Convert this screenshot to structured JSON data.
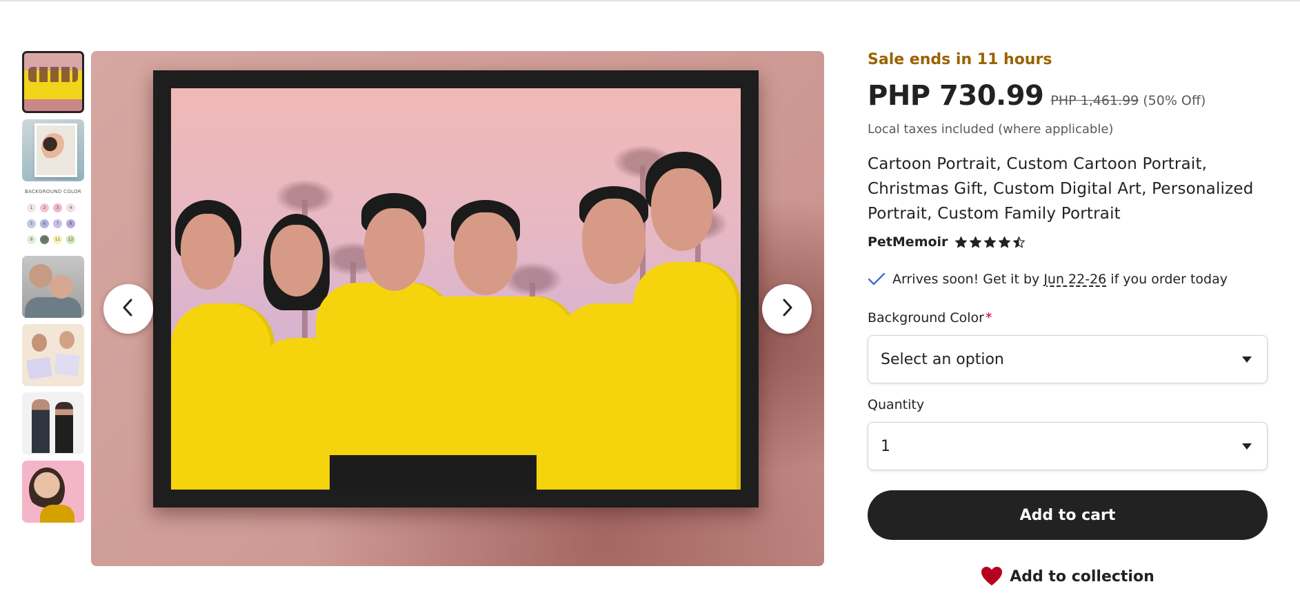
{
  "thumbnails": {
    "color_chart_caption": "BACKGROUND COLOR",
    "color_chart_numbers": [
      "1",
      "2",
      "3",
      "4",
      "5",
      "6",
      "7",
      "8",
      "9",
      "10",
      "11",
      "12"
    ],
    "color_chart_colors": [
      "#f6e3e6",
      "#f6c0d3",
      "#f1b6cc",
      "#f2dce3",
      "#c9c6ea",
      "#aeb6df",
      "#c9bfe6",
      "#b6a9d9",
      "#d9f0d3",
      "#6c7b6a",
      "#fbf0b2",
      "#cfe7b3"
    ]
  },
  "sale_text": "Sale ends in 11 hours",
  "price": "PHP 730.99",
  "original_price": "PHP 1,461.99",
  "discount": "(50% Off)",
  "tax_note": "Local taxes included (where applicable)",
  "title": "Cartoon Portrait, Custom Cartoon Portrait, Christmas Gift, Custom Digital Art, Personalized Portrait, Custom Family Portrait",
  "shop_name": "PetMemoir",
  "rating_stars": 4.5,
  "arrives": {
    "prefix": "Arrives soon! Get it by ",
    "date": "Jun 22-26",
    "suffix": " if you order today"
  },
  "background_color": {
    "label": "Background Color",
    "required_mark": "*",
    "value": "Select an option"
  },
  "quantity": {
    "label": "Quantity",
    "value": "1"
  },
  "add_to_cart": "Add to cart",
  "add_to_collection": "Add to collection",
  "colors": {
    "sale": "#9a6300",
    "button": "#222222",
    "heart": "#b7001e",
    "shirt": "#f6d40d"
  }
}
